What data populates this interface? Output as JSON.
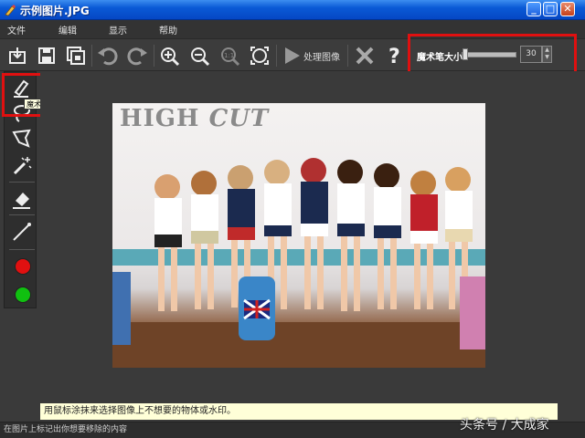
{
  "window": {
    "title": "示例图片.JPG"
  },
  "menu": {
    "file": "文件",
    "edit": "编辑",
    "view": "显示",
    "help": "帮助"
  },
  "toolbar": {
    "process_label": "处理图像",
    "buttons": [
      "open-icon",
      "save-icon",
      "save-as-icon",
      "undo-icon",
      "redo-icon",
      "zoom-in-icon",
      "zoom-out-icon",
      "actual-size-icon",
      "fit-window-icon",
      "process-icon",
      "clear-icon",
      "help-icon"
    ]
  },
  "brush": {
    "label": "魔术笔大小",
    "value": "30",
    "level_fraction": 0.05
  },
  "tools": {
    "tooltip": "魔术笔",
    "items": [
      "marker-icon",
      "lasso-icon",
      "polygon-lasso-icon",
      "magic-wand-icon",
      "eraser-icon",
      "line-icon"
    ]
  },
  "colors": {
    "accent": "#0a5ad6",
    "marker_red": "#e01010",
    "marker_green": "#10c010",
    "highlight": "#e01010"
  },
  "photo": {
    "title_plain": "HIGH ",
    "title_italic": "CUT"
  },
  "hint": "用鼠标涂抹来选择图像上不想要的物体或水印。",
  "status": "在图片上标记出你想要移除的内容",
  "watermark": "头条号 / 大成家"
}
